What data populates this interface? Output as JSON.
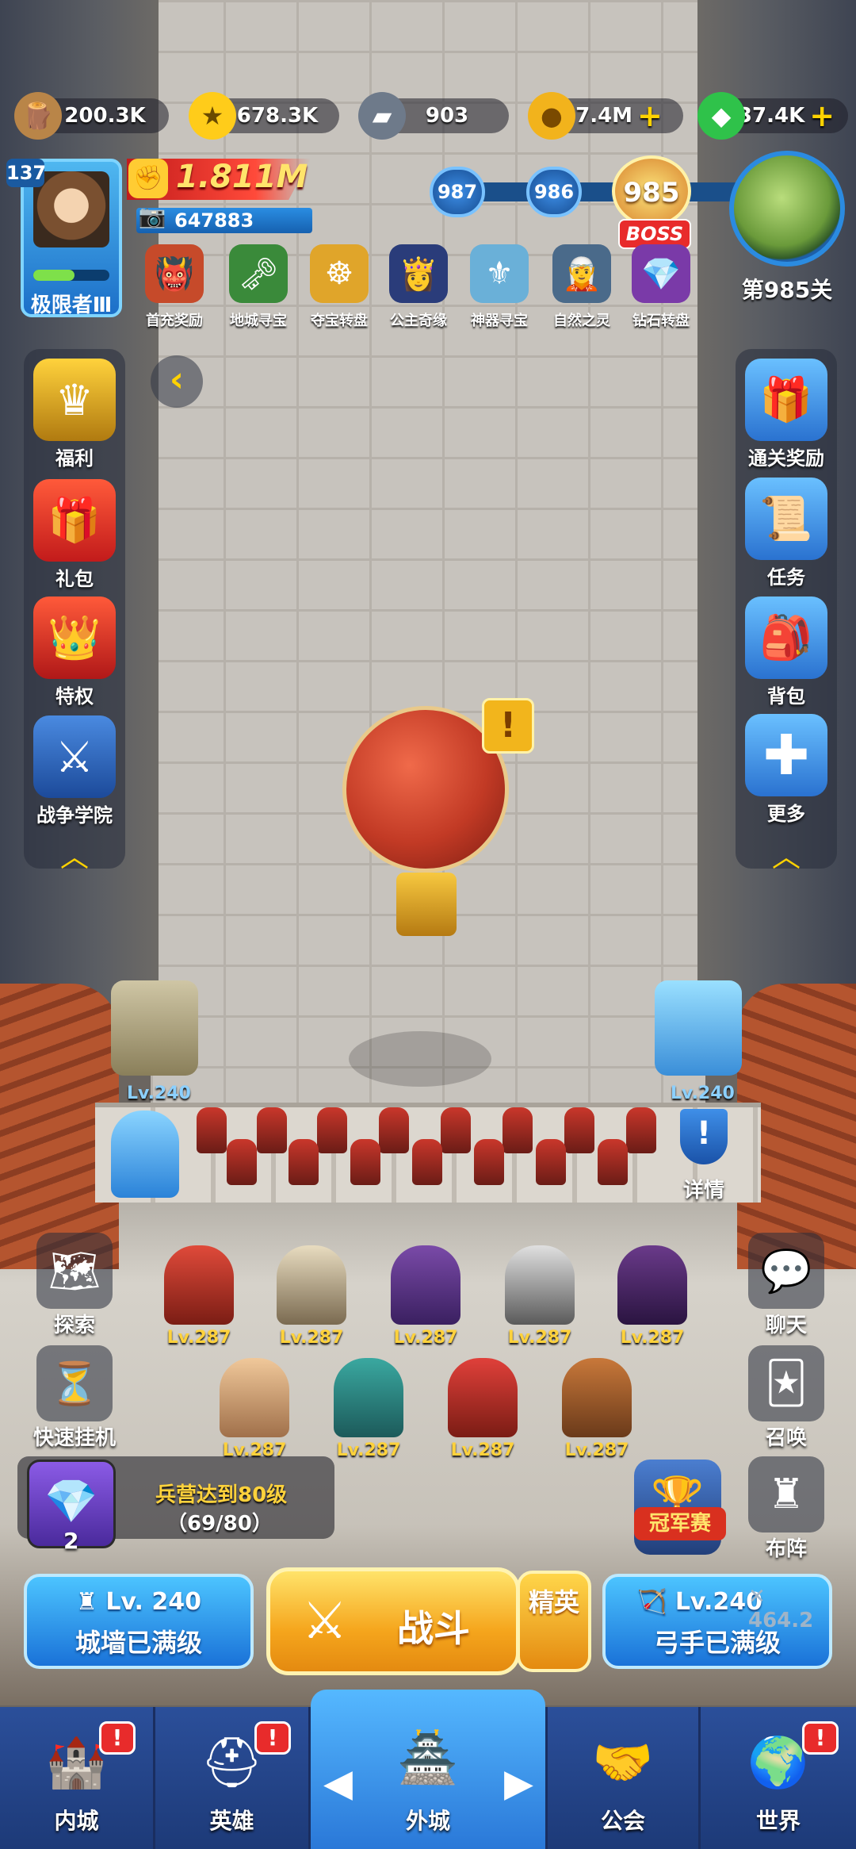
{
  "resources": [
    {
      "id": "wood",
      "value": "200.3K",
      "icon": "wood-log-icon",
      "plus": false
    },
    {
      "id": "gold-star",
      "value": "678.3K",
      "icon": "star-coin-icon",
      "plus": false
    },
    {
      "id": "iron",
      "value": "903",
      "icon": "iron-ingot-icon",
      "plus": false
    },
    {
      "id": "coin",
      "value": "7.4M",
      "icon": "gold-coin-icon",
      "plus": true
    },
    {
      "id": "gem",
      "value": "37.4K",
      "icon": "green-gem-icon",
      "plus": true
    }
  ],
  "plus_symbol": "+",
  "player": {
    "level": "137",
    "rank": "极限者Ⅲ",
    "rank_progress": 0.54,
    "power": "1.811M",
    "score": "647883"
  },
  "stage": {
    "prev2": "987",
    "prev1": "986",
    "current": "985",
    "boss_tag": "BOSS",
    "label": "第985关"
  },
  "events": [
    {
      "label": "首充奖励",
      "icon": "ogre-icon"
    },
    {
      "label": "地城寻宝",
      "icon": "treasure-key-icon"
    },
    {
      "label": "夺宝转盘",
      "icon": "wheel-icon"
    },
    {
      "label": "公主奇缘",
      "icon": "princess-icon"
    },
    {
      "label": "神器寻宝",
      "icon": "artifact-icon"
    },
    {
      "label": "自然之灵",
      "icon": "nature-spirit-icon"
    },
    {
      "label": "钻石转盘",
      "icon": "diamond-wheel-icon"
    }
  ],
  "left_menu": [
    {
      "label": "福利",
      "icon": "crown-shield-icon"
    },
    {
      "label": "礼包",
      "icon": "gift-icon"
    },
    {
      "label": "特权",
      "icon": "crown-badge-icon"
    },
    {
      "label": "战争学院",
      "icon": "crossed-swords-icon"
    }
  ],
  "right_menu": [
    {
      "label": "通关奖励",
      "icon": "gift-box-icon"
    },
    {
      "label": "任务",
      "icon": "scroll-icon"
    },
    {
      "label": "背包",
      "icon": "backpack-icon"
    },
    {
      "label": "更多",
      "icon": "plus-icon"
    }
  ],
  "collapse_arrow": "‹",
  "alert_mark": "!",
  "towers": {
    "left_lv": "Lv.240",
    "right_lv": "Lv.240",
    "detail_label": "详情"
  },
  "heroes": [
    {
      "lv": "Lv.287"
    },
    {
      "lv": "Lv.287"
    },
    {
      "lv": "Lv.287"
    },
    {
      "lv": "Lv.287"
    },
    {
      "lv": "Lv.287"
    },
    {
      "lv": "Lv.287"
    },
    {
      "lv": "Lv.287"
    },
    {
      "lv": "Lv.287"
    },
    {
      "lv": "Lv.287"
    }
  ],
  "left_lower": [
    {
      "label": "探索",
      "icon": "map-icon"
    },
    {
      "label": "快速挂机",
      "icon": "hourglass-icon"
    }
  ],
  "right_lower": [
    {
      "label": "聊天",
      "icon": "chat-bubble-icon"
    },
    {
      "label": "召唤",
      "icon": "cards-icon"
    },
    {
      "label": "布阵",
      "icon": "chess-rook-icon"
    }
  ],
  "quest": {
    "title": "兵营达到80级",
    "progress": "（69/80）",
    "count": "2"
  },
  "champion": {
    "label": "冠军赛"
  },
  "actions": {
    "wall": {
      "lv": "Lv. 240",
      "status": "城墙已满级"
    },
    "battle": {
      "label": "战斗"
    },
    "elite": {
      "label": "精英"
    },
    "archer": {
      "lv": "Lv.240",
      "status": "弓手已满级",
      "power": "464.2"
    }
  },
  "nav": [
    {
      "label": "内城",
      "icon": "castle-icon",
      "alert": true
    },
    {
      "label": "英雄",
      "icon": "helmet-icon",
      "alert": true
    },
    {
      "label": "外城",
      "icon": "tower-banner-icon",
      "alert": false
    },
    {
      "label": "公会",
      "icon": "handshake-icon",
      "alert": false
    },
    {
      "label": "世界",
      "icon": "globe-icon",
      "alert": true
    }
  ],
  "colors": {
    "accent_blue": "#2a78d8",
    "gold": "#ffd23c",
    "alert_red": "#e82b2b"
  }
}
